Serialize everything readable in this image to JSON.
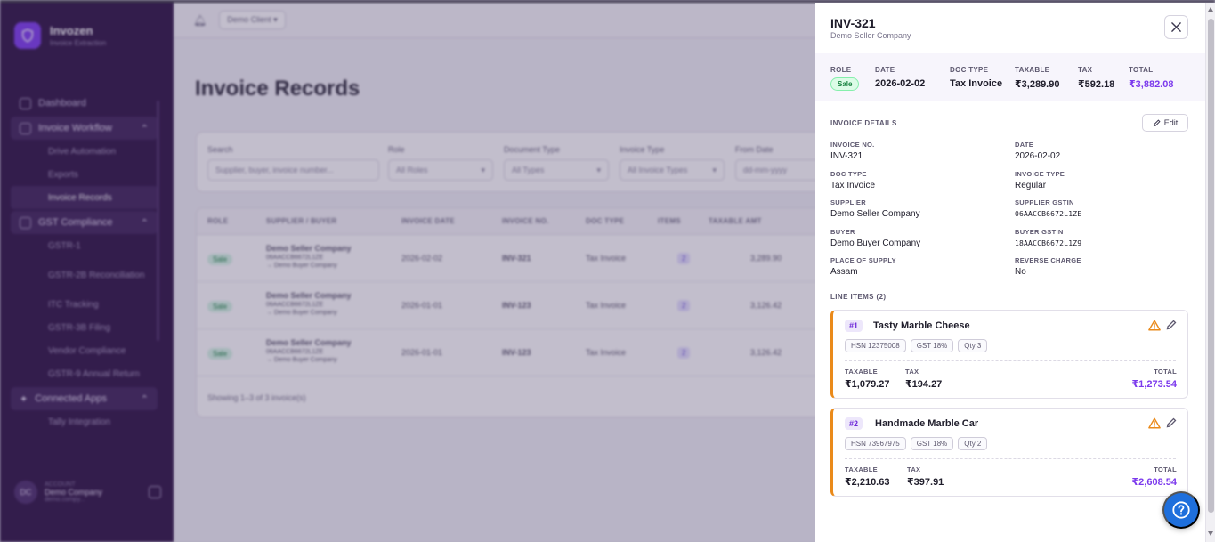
{
  "sidebar": {
    "brand_name": "Invozen",
    "brand_sub": "Invoice Extraction",
    "dashboard": "Dashboard",
    "invoice_workflow": "Invoice Workflow",
    "drive_automation": "Drive Automation",
    "exports": "Exports",
    "invoice_records": "Invoice Records",
    "gst_compliance": "GST Compliance",
    "gstr1": "GSTR-1",
    "gstr2b": "GSTR-2B Reconciliation",
    "itc_tracking": "ITC Tracking",
    "gstr3b": "GSTR-3B Filing",
    "vendor_compliance": "Vendor Compliance",
    "gstr9": "GSTR-9 Annual Return",
    "connected_apps": "Connected Apps",
    "tally": "Tally Integration",
    "account_label": "ACCOUNT",
    "account_initials": "DC",
    "account_name": "Demo Company",
    "account_sub": "demo.compy..."
  },
  "header": {
    "client": "Demo Client"
  },
  "page": {
    "title": "Invoice Records"
  },
  "filters": {
    "search_label": "Search",
    "search_placeholder": "Supplier, buyer, invoice number...",
    "role_label": "Role",
    "role_value": "All Roles",
    "doctype_label": "Document Type",
    "doctype_value": "All Types",
    "invtype_label": "Invoice Type",
    "invtype_value": "All Invoice Types",
    "from_label": "From Date",
    "from_value": "dd-mm-yyyy"
  },
  "table": {
    "headers": [
      "ROLE",
      "SUPPLIER / BUYER",
      "INVOICE DATE",
      "INVOICE NO.",
      "DOC TYPE",
      "ITEMS",
      "TAXABLE AMT"
    ],
    "rows": [
      {
        "role": "Sale",
        "supplier": "Demo Seller Company",
        "gstin": "06AACCB6672L1ZE",
        "buyer": "→ Demo Buyer Company",
        "date": "2026-02-02",
        "no": "INV-321",
        "doctype": "Tax Invoice",
        "items": "2",
        "taxable": "3,289.90"
      },
      {
        "role": "Sale",
        "supplier": "Demo Seller Company",
        "gstin": "06AACCB6672L1ZE",
        "buyer": "→ Demo Buyer Company",
        "date": "2026-01-01",
        "no": "INV-123",
        "doctype": "Tax Invoice",
        "items": "2",
        "taxable": "3,126.42"
      },
      {
        "role": "Sale",
        "supplier": "Demo Seller Company",
        "gstin": "06AACCB6672L1ZE",
        "buyer": "→ Demo Buyer Company",
        "date": "2026-01-01",
        "no": "INV-123",
        "doctype": "Tax Invoice",
        "items": "2",
        "taxable": "3,126.42"
      }
    ],
    "footer": "Showing 1–3 of 3 invoice(s)"
  },
  "drawer": {
    "title": "INV-321",
    "subtitle": "Demo Seller Company",
    "summary": {
      "role_label": "ROLE",
      "role": "Sale",
      "date_label": "DATE",
      "date": "2026-02-02",
      "doctype_label": "DOC TYPE",
      "doctype": "Tax Invoice",
      "taxable_label": "TAXABLE",
      "taxable": "₹3,289.90",
      "tax_label": "TAX",
      "tax": "₹592.18",
      "total_label": "TOTAL",
      "total": "₹3,882.08"
    },
    "details_label": "INVOICE DETAILS",
    "edit_label": "Edit",
    "details": {
      "invoice_no_label": "INVOICE NO.",
      "invoice_no": "INV-321",
      "date_label": "DATE",
      "date": "2026-02-02",
      "doc_type_label": "DOC TYPE",
      "doc_type": "Tax Invoice",
      "invoice_type_label": "INVOICE TYPE",
      "invoice_type": "Regular",
      "supplier_label": "SUPPLIER",
      "supplier": "Demo Seller Company",
      "supplier_gstin_label": "SUPPLIER GSTIN",
      "supplier_gstin": "06AACCB6672L1ZE",
      "buyer_label": "BUYER",
      "buyer": "Demo Buyer Company",
      "buyer_gstin_label": "BUYER GSTIN",
      "buyer_gstin": "18AACCB6672L1Z9",
      "pos_label": "PLACE OF SUPPLY",
      "pos": "Assam",
      "rc_label": "REVERSE CHARGE",
      "rc": "No"
    },
    "line_items_label": "LINE ITEMS (2)",
    "line_items": [
      {
        "num": "#1",
        "name": "Tasty Marble Cheese",
        "hsn": "HSN 12375008",
        "gst": "GST 18%",
        "qty": "Qty 3",
        "taxable_label": "TAXABLE",
        "taxable": "₹1,079.27",
        "tax_label": "TAX",
        "tax": "₹194.27",
        "total_label": "TOTAL",
        "total": "₹1,273.54"
      },
      {
        "num": "#2",
        "name": "Handmade Marble Car",
        "hsn": "HSN 73967975",
        "gst": "GST 18%",
        "qty": "Qty 2",
        "taxable_label": "TAXABLE",
        "taxable": "₹2,210.63",
        "tax_label": "TAX",
        "tax": "₹397.91",
        "total_label": "TOTAL",
        "total": "₹2,608.54"
      }
    ]
  },
  "colors": {
    "accent": "#7c3aed",
    "warning": "#ea8a1a",
    "sale_green": "#15803d",
    "help_blue": "#1e6fdc",
    "sidebar_bg": "#2d1243"
  }
}
